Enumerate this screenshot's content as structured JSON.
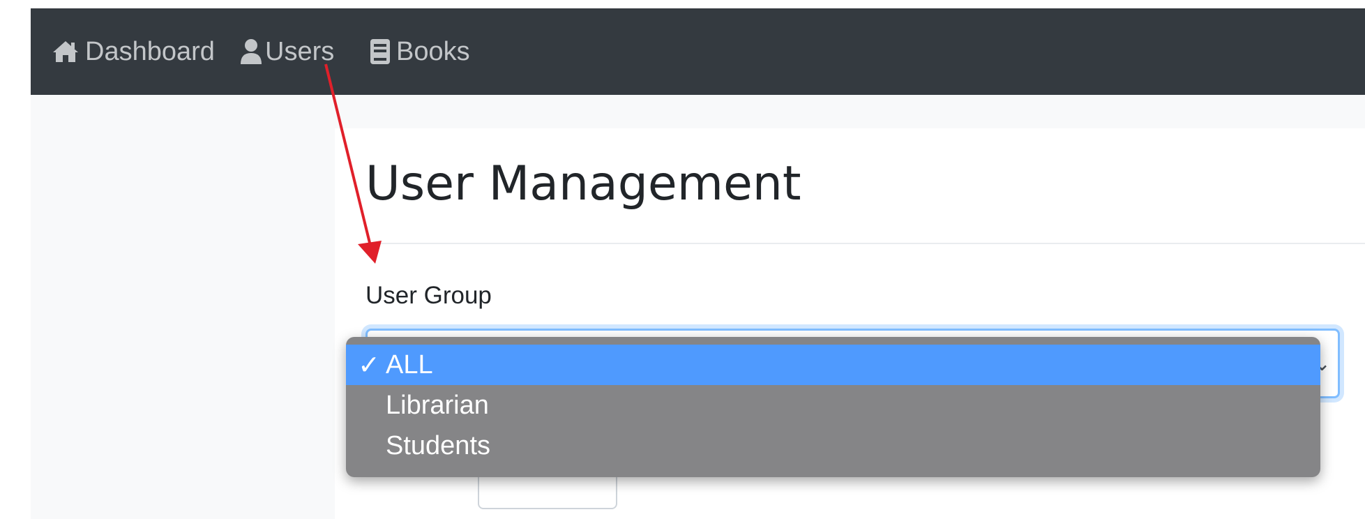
{
  "navbar": {
    "items": [
      {
        "label": "Dashboard",
        "icon": "home-icon"
      },
      {
        "label": "Users",
        "icon": "user-icon"
      },
      {
        "label": "Books",
        "icon": "book-icon"
      }
    ]
  },
  "main": {
    "title": "User Management",
    "user_group_label": "User Group",
    "select": {
      "selected_value": "ALL",
      "options": [
        {
          "label": "ALL",
          "selected": true,
          "check": "✓"
        },
        {
          "label": "Librarian",
          "selected": false,
          "check": ""
        },
        {
          "label": "Students",
          "selected": false,
          "check": ""
        }
      ]
    }
  },
  "annotation": {
    "arrow_color": "#e0202a",
    "arrow_icon": "red-arrow-annotation"
  },
  "colors": {
    "navbar_bg": "#343a40",
    "nav_text": "#c3c6c9",
    "option_highlight": "#4f9afe",
    "dropdown_bg": "#858587",
    "focus_border": "#80bdff"
  }
}
